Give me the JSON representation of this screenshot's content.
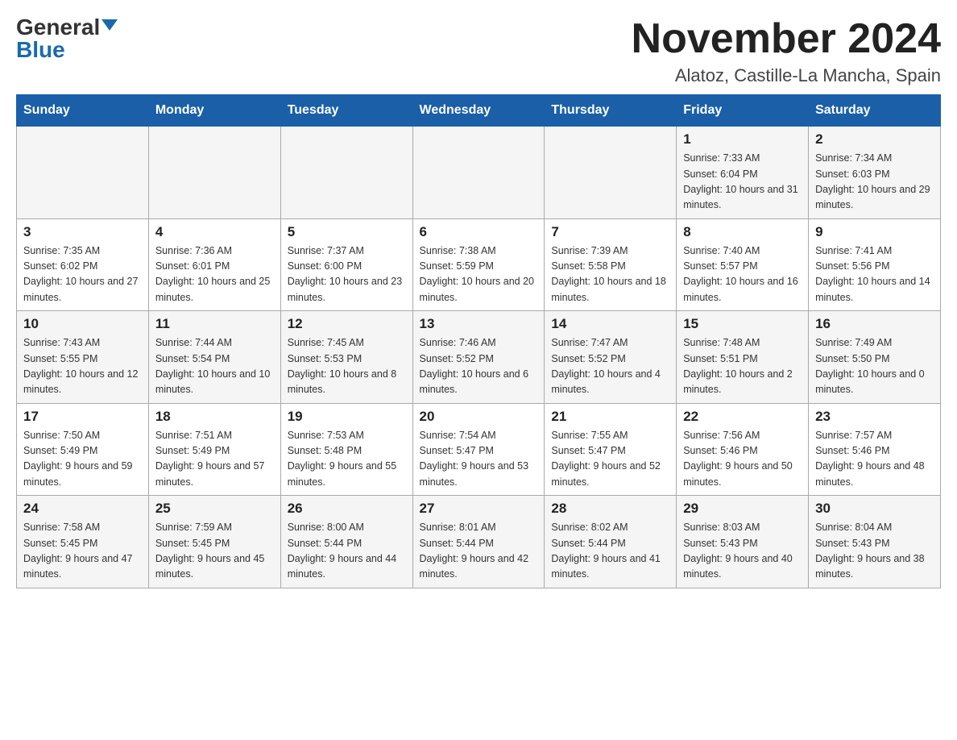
{
  "logo": {
    "general": "General",
    "blue": "Blue"
  },
  "title": {
    "month_year": "November 2024",
    "location": "Alatoz, Castille-La Mancha, Spain"
  },
  "days_of_week": [
    "Sunday",
    "Monday",
    "Tuesday",
    "Wednesday",
    "Thursday",
    "Friday",
    "Saturday"
  ],
  "weeks": [
    [
      {
        "day": "",
        "info": ""
      },
      {
        "day": "",
        "info": ""
      },
      {
        "day": "",
        "info": ""
      },
      {
        "day": "",
        "info": ""
      },
      {
        "day": "",
        "info": ""
      },
      {
        "day": "1",
        "info": "Sunrise: 7:33 AM\nSunset: 6:04 PM\nDaylight: 10 hours and 31 minutes."
      },
      {
        "day": "2",
        "info": "Sunrise: 7:34 AM\nSunset: 6:03 PM\nDaylight: 10 hours and 29 minutes."
      }
    ],
    [
      {
        "day": "3",
        "info": "Sunrise: 7:35 AM\nSunset: 6:02 PM\nDaylight: 10 hours and 27 minutes."
      },
      {
        "day": "4",
        "info": "Sunrise: 7:36 AM\nSunset: 6:01 PM\nDaylight: 10 hours and 25 minutes."
      },
      {
        "day": "5",
        "info": "Sunrise: 7:37 AM\nSunset: 6:00 PM\nDaylight: 10 hours and 23 minutes."
      },
      {
        "day": "6",
        "info": "Sunrise: 7:38 AM\nSunset: 5:59 PM\nDaylight: 10 hours and 20 minutes."
      },
      {
        "day": "7",
        "info": "Sunrise: 7:39 AM\nSunset: 5:58 PM\nDaylight: 10 hours and 18 minutes."
      },
      {
        "day": "8",
        "info": "Sunrise: 7:40 AM\nSunset: 5:57 PM\nDaylight: 10 hours and 16 minutes."
      },
      {
        "day": "9",
        "info": "Sunrise: 7:41 AM\nSunset: 5:56 PM\nDaylight: 10 hours and 14 minutes."
      }
    ],
    [
      {
        "day": "10",
        "info": "Sunrise: 7:43 AM\nSunset: 5:55 PM\nDaylight: 10 hours and 12 minutes."
      },
      {
        "day": "11",
        "info": "Sunrise: 7:44 AM\nSunset: 5:54 PM\nDaylight: 10 hours and 10 minutes."
      },
      {
        "day": "12",
        "info": "Sunrise: 7:45 AM\nSunset: 5:53 PM\nDaylight: 10 hours and 8 minutes."
      },
      {
        "day": "13",
        "info": "Sunrise: 7:46 AM\nSunset: 5:52 PM\nDaylight: 10 hours and 6 minutes."
      },
      {
        "day": "14",
        "info": "Sunrise: 7:47 AM\nSunset: 5:52 PM\nDaylight: 10 hours and 4 minutes."
      },
      {
        "day": "15",
        "info": "Sunrise: 7:48 AM\nSunset: 5:51 PM\nDaylight: 10 hours and 2 minutes."
      },
      {
        "day": "16",
        "info": "Sunrise: 7:49 AM\nSunset: 5:50 PM\nDaylight: 10 hours and 0 minutes."
      }
    ],
    [
      {
        "day": "17",
        "info": "Sunrise: 7:50 AM\nSunset: 5:49 PM\nDaylight: 9 hours and 59 minutes."
      },
      {
        "day": "18",
        "info": "Sunrise: 7:51 AM\nSunset: 5:49 PM\nDaylight: 9 hours and 57 minutes."
      },
      {
        "day": "19",
        "info": "Sunrise: 7:53 AM\nSunset: 5:48 PM\nDaylight: 9 hours and 55 minutes."
      },
      {
        "day": "20",
        "info": "Sunrise: 7:54 AM\nSunset: 5:47 PM\nDaylight: 9 hours and 53 minutes."
      },
      {
        "day": "21",
        "info": "Sunrise: 7:55 AM\nSunset: 5:47 PM\nDaylight: 9 hours and 52 minutes."
      },
      {
        "day": "22",
        "info": "Sunrise: 7:56 AM\nSunset: 5:46 PM\nDaylight: 9 hours and 50 minutes."
      },
      {
        "day": "23",
        "info": "Sunrise: 7:57 AM\nSunset: 5:46 PM\nDaylight: 9 hours and 48 minutes."
      }
    ],
    [
      {
        "day": "24",
        "info": "Sunrise: 7:58 AM\nSunset: 5:45 PM\nDaylight: 9 hours and 47 minutes."
      },
      {
        "day": "25",
        "info": "Sunrise: 7:59 AM\nSunset: 5:45 PM\nDaylight: 9 hours and 45 minutes."
      },
      {
        "day": "26",
        "info": "Sunrise: 8:00 AM\nSunset: 5:44 PM\nDaylight: 9 hours and 44 minutes."
      },
      {
        "day": "27",
        "info": "Sunrise: 8:01 AM\nSunset: 5:44 PM\nDaylight: 9 hours and 42 minutes."
      },
      {
        "day": "28",
        "info": "Sunrise: 8:02 AM\nSunset: 5:44 PM\nDaylight: 9 hours and 41 minutes."
      },
      {
        "day": "29",
        "info": "Sunrise: 8:03 AM\nSunset: 5:43 PM\nDaylight: 9 hours and 40 minutes."
      },
      {
        "day": "30",
        "info": "Sunrise: 8:04 AM\nSunset: 5:43 PM\nDaylight: 9 hours and 38 minutes."
      }
    ]
  ]
}
